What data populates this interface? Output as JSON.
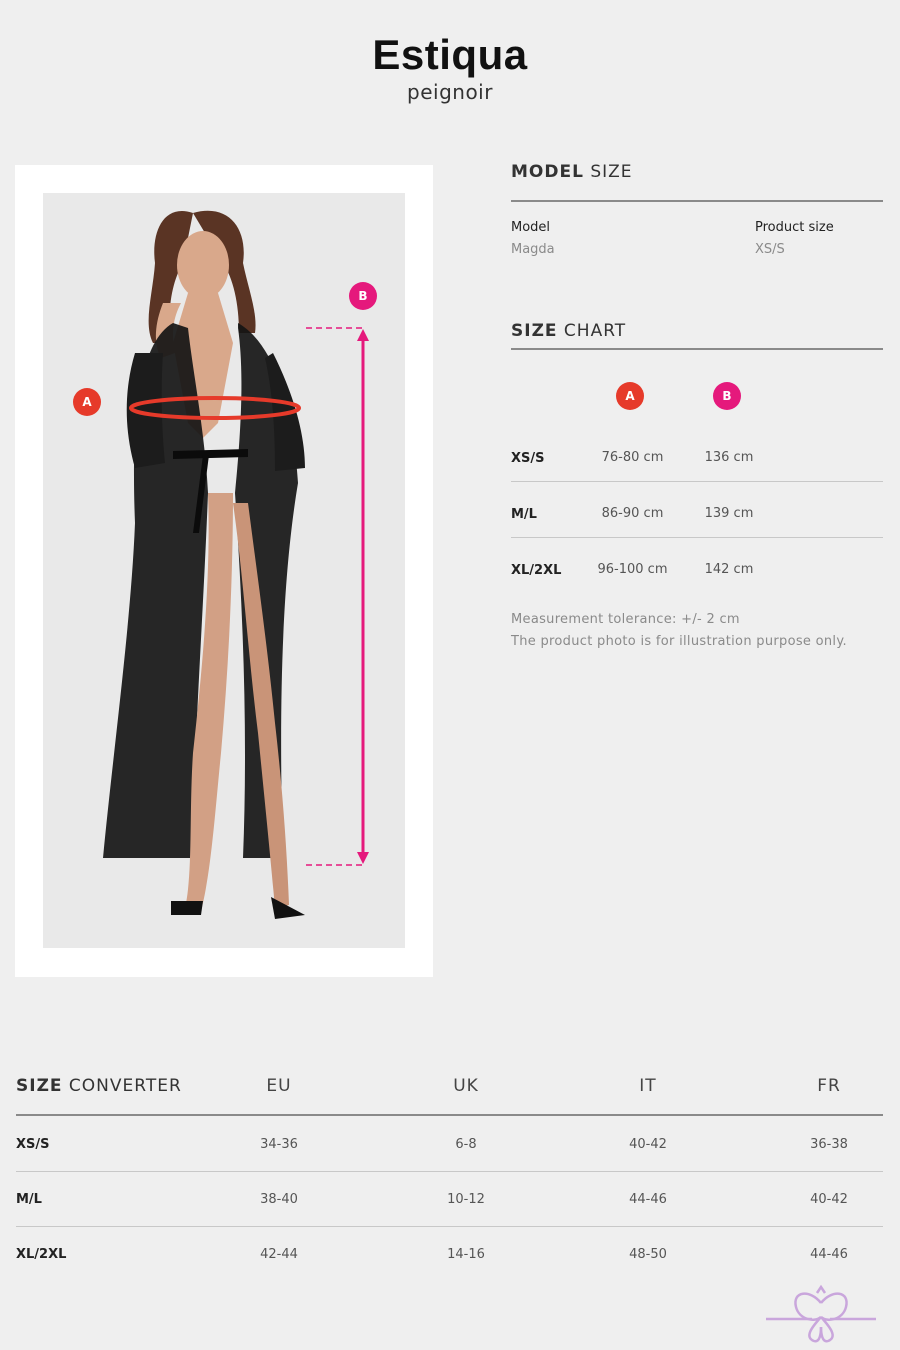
{
  "header": {
    "brand": "Estiqua",
    "subtitle": "peignoir"
  },
  "model_size": {
    "heading_bold": "MODEL",
    "heading_rest": " SIZE",
    "model_label": "Model",
    "model_value": "Magda",
    "size_label": "Product size",
    "size_value": "XS/S"
  },
  "size_chart": {
    "heading_bold": "SIZE",
    "heading_rest": " CHART",
    "markers": [
      "A",
      "B"
    ],
    "rows": [
      {
        "size": "XS/S",
        "a": "76-80 cm",
        "b": "136 cm"
      },
      {
        "size": "M/L",
        "a": "86-90 cm",
        "b": "139 cm"
      },
      {
        "size": "XL/2XL",
        "a": "96-100 cm",
        "b": "142 cm"
      }
    ],
    "note_1": "Measurement tolerance: +/- 2 cm",
    "note_2": "The product photo is for illustration purpose only."
  },
  "photo": {
    "marker_a": "A",
    "marker_b": "B"
  },
  "size_converter": {
    "heading_bold": "SIZE",
    "heading_rest": " CONVERTER",
    "columns": [
      "EU",
      "UK",
      "IT",
      "FR"
    ],
    "rows": [
      {
        "size": "XS/S",
        "values": [
          "34-36",
          "6-8",
          "40-42",
          "36-38"
        ]
      },
      {
        "size": "M/L",
        "values": [
          "38-40",
          "10-12",
          "44-46",
          "40-42"
        ]
      },
      {
        "size": "XL/2XL",
        "values": [
          "42-44",
          "14-16",
          "48-50",
          "44-46"
        ]
      }
    ]
  },
  "colors": {
    "marker_a": "#e63a2a",
    "marker_b": "#e5197c",
    "background": "#efefef",
    "logo": "#c9a6dc"
  },
  "icons": {
    "logo": "butterfly-logo-icon"
  }
}
